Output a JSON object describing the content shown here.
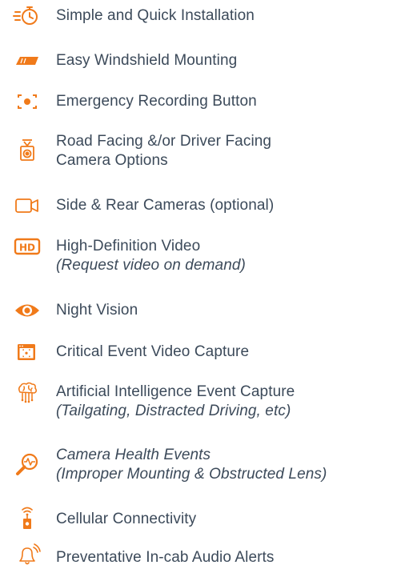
{
  "accent_color": "#f07a1a",
  "text_color": "#3c4a5a",
  "features": [
    {
      "icon": "stopwatch-icon",
      "title": "Simple and Quick Installation"
    },
    {
      "icon": "windshield-icon",
      "title": "Easy Windshield Mounting"
    },
    {
      "icon": "record-button-icon",
      "title": "Emergency Recording Button"
    },
    {
      "icon": "dashcam-icon",
      "title": "Road Facing &/or Driver Facing",
      "subtitle": "Camera Options"
    },
    {
      "icon": "video-camera-icon",
      "title": "Side & Rear Cameras (optional)"
    },
    {
      "icon": "hd-icon",
      "title": "High-Definition Video",
      "subtitle": "(Request video on demand)"
    },
    {
      "icon": "eye-icon",
      "title": "Night Vision"
    },
    {
      "icon": "event-capture-icon",
      "title": "Critical Event Video Capture"
    },
    {
      "icon": "ai-brain-icon",
      "title": "Artificial Intelligence Event Capture",
      "subtitle": "(Tailgating, Distracted Driving, etc)"
    },
    {
      "icon": "health-magnifier-icon",
      "title": "Camera Health Events",
      "subtitle": "(Improper Mounting & Obstructed Lens)"
    },
    {
      "icon": "cellular-icon",
      "title": "Cellular Connectivity"
    },
    {
      "icon": "bell-alert-icon",
      "title": "Preventative In-cab Audio Alerts"
    }
  ]
}
